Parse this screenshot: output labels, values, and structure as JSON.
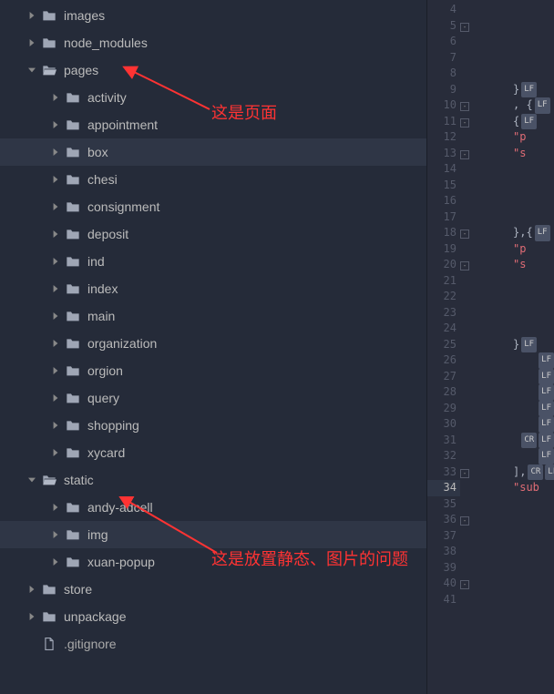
{
  "tree": [
    {
      "name": "images",
      "depth": 1,
      "type": "folder",
      "expanded": false
    },
    {
      "name": "node_modules",
      "depth": 1,
      "type": "folder",
      "expanded": false
    },
    {
      "name": "pages",
      "depth": 1,
      "type": "folder",
      "expanded": true
    },
    {
      "name": "activity",
      "depth": 2,
      "type": "folder",
      "expanded": false
    },
    {
      "name": "appointment",
      "depth": 2,
      "type": "folder",
      "expanded": false
    },
    {
      "name": "box",
      "depth": 2,
      "type": "folder",
      "expanded": false,
      "selected": true
    },
    {
      "name": "chesi",
      "depth": 2,
      "type": "folder",
      "expanded": false
    },
    {
      "name": "consignment",
      "depth": 2,
      "type": "folder",
      "expanded": false
    },
    {
      "name": "deposit",
      "depth": 2,
      "type": "folder",
      "expanded": false
    },
    {
      "name": "ind",
      "depth": 2,
      "type": "folder",
      "expanded": false
    },
    {
      "name": "index",
      "depth": 2,
      "type": "folder",
      "expanded": false
    },
    {
      "name": "main",
      "depth": 2,
      "type": "folder",
      "expanded": false
    },
    {
      "name": "organization",
      "depth": 2,
      "type": "folder",
      "expanded": false
    },
    {
      "name": "orgion",
      "depth": 2,
      "type": "folder",
      "expanded": false
    },
    {
      "name": "query",
      "depth": 2,
      "type": "folder",
      "expanded": false
    },
    {
      "name": "shopping",
      "depth": 2,
      "type": "folder",
      "expanded": false
    },
    {
      "name": "xycard",
      "depth": 2,
      "type": "folder",
      "expanded": false
    },
    {
      "name": "static",
      "depth": 1,
      "type": "folder",
      "expanded": true
    },
    {
      "name": "andy-adcell",
      "depth": 2,
      "type": "folder",
      "expanded": false
    },
    {
      "name": "img",
      "depth": 2,
      "type": "folder",
      "expanded": false,
      "selected": true
    },
    {
      "name": "xuan-popup",
      "depth": 2,
      "type": "folder",
      "expanded": false
    },
    {
      "name": "store",
      "depth": 1,
      "type": "folder",
      "expanded": false
    },
    {
      "name": "unpackage",
      "depth": 1,
      "type": "folder",
      "expanded": false
    },
    {
      "name": ".gitignore",
      "depth": 1,
      "type": "file"
    }
  ],
  "annotations": {
    "pages_label": "这是页面",
    "static_label": "这是放置静态、图片的问题"
  },
  "editor": {
    "lines": [
      {
        "num": 4,
        "fold": "",
        "code": "",
        "lf": ""
      },
      {
        "num": 5,
        "fold": "⊟",
        "code": "",
        "lf": ""
      },
      {
        "num": 6,
        "fold": "",
        "code": "",
        "lf": ""
      },
      {
        "num": 7,
        "fold": "",
        "code": "",
        "lf": ""
      },
      {
        "num": 8,
        "fold": "",
        "code": "",
        "lf": ""
      },
      {
        "num": 9,
        "fold": "",
        "code": "}",
        "lf": "LF",
        "cls": "tok-punc"
      },
      {
        "num": 10,
        "fold": "⊟",
        "code": ", {",
        "lf": "LF",
        "cls": "tok-punc"
      },
      {
        "num": 11,
        "fold": "⊟",
        "code": "{",
        "lf": "LF",
        "cls": "tok-punc"
      },
      {
        "num": 12,
        "fold": "",
        "code": "\"p",
        "lf": "",
        "cls": "tok-red"
      },
      {
        "num": 13,
        "fold": "⊟",
        "code": "\"s",
        "lf": "",
        "cls": "tok-red"
      },
      {
        "num": 14,
        "fold": "",
        "code": "",
        "lf": ""
      },
      {
        "num": 15,
        "fold": "",
        "code": "",
        "lf": ""
      },
      {
        "num": 16,
        "fold": "",
        "code": "",
        "lf": ""
      },
      {
        "num": 17,
        "fold": "",
        "code": "",
        "lf": ""
      },
      {
        "num": 18,
        "fold": "⊟",
        "code": "},{",
        "lf": "LF",
        "cls": "tok-punc"
      },
      {
        "num": 19,
        "fold": "",
        "code": "\"p",
        "lf": "",
        "cls": "tok-red"
      },
      {
        "num": 20,
        "fold": "⊟",
        "code": "\"s",
        "lf": "",
        "cls": "tok-red"
      },
      {
        "num": 21,
        "fold": "",
        "code": "",
        "lf": ""
      },
      {
        "num": 22,
        "fold": "",
        "code": "",
        "lf": ""
      },
      {
        "num": 23,
        "fold": "",
        "code": "",
        "lf": ""
      },
      {
        "num": 24,
        "fold": "",
        "code": "",
        "lf": ""
      },
      {
        "num": 25,
        "fold": "",
        "code": "}",
        "lf": "LF",
        "cls": "tok-punc"
      },
      {
        "num": 26,
        "fold": "",
        "code": "",
        "lf": "LF"
      },
      {
        "num": 27,
        "fold": "",
        "code": "",
        "lf": "LF"
      },
      {
        "num": 28,
        "fold": "",
        "code": "",
        "lf": "LF"
      },
      {
        "num": 29,
        "fold": "",
        "code": "",
        "lf": "LF"
      },
      {
        "num": 30,
        "fold": "",
        "code": "",
        "lf": "LF"
      },
      {
        "num": 31,
        "fold": "",
        "code": "",
        "lf": "CRLF"
      },
      {
        "num": 32,
        "fold": "",
        "code": "",
        "lf": "LF"
      },
      {
        "num": 33,
        "fold": "⊟",
        "code": "],",
        "lf": "CRLF",
        "cls": "tok-punc"
      },
      {
        "num": 34,
        "fold": "",
        "code": "\"sub",
        "lf": "",
        "cls": "tok-red",
        "highlight": true
      },
      {
        "num": 35,
        "fold": "",
        "code": "",
        "lf": ""
      },
      {
        "num": 36,
        "fold": "⊟",
        "code": "",
        "lf": ""
      },
      {
        "num": 37,
        "fold": "",
        "code": "",
        "lf": ""
      },
      {
        "num": 38,
        "fold": "",
        "code": "",
        "lf": ""
      },
      {
        "num": 39,
        "fold": "",
        "code": "",
        "lf": ""
      },
      {
        "num": 40,
        "fold": "⊟",
        "code": "",
        "lf": ""
      },
      {
        "num": 41,
        "fold": "",
        "code": "",
        "lf": ""
      }
    ]
  }
}
